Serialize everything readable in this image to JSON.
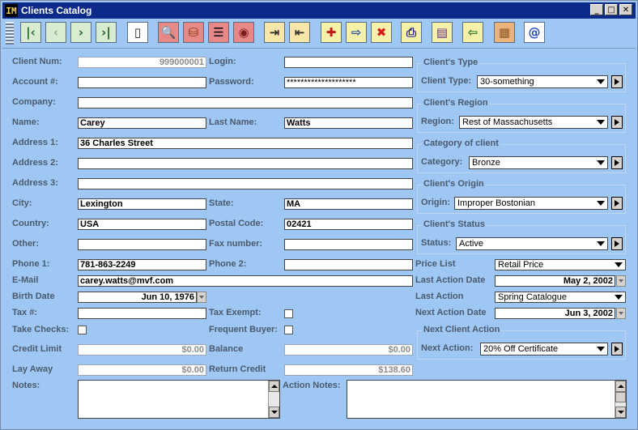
{
  "window": {
    "title": "Clients Catalog",
    "app_icon": "IM",
    "minimize_glyph": "_",
    "maximize_glyph": "□",
    "close_glyph": "✕"
  },
  "toolbar": {
    "buttons": [
      {
        "name": "first-record",
        "icon": "first-record-icon",
        "glyph": "|‹",
        "bg": "#d8ecd2",
        "fg": "#2b6b2b"
      },
      {
        "name": "previous-record",
        "icon": "previous-record-icon",
        "glyph": "‹",
        "bg": "#d8ecd2",
        "fg": "#9aa79a"
      },
      {
        "name": "next-record",
        "icon": "next-record-icon",
        "glyph": "›",
        "bg": "#d8ecd2",
        "fg": "#1f5c1f"
      },
      {
        "name": "last-record",
        "icon": "last-record-icon",
        "glyph": "›|",
        "bg": "#d8ecd2",
        "fg": "#1f5c1f"
      },
      {
        "name": "new-document",
        "icon": "document-icon",
        "glyph": "▯",
        "bg": "#ffffff",
        "fg": "#222222"
      },
      {
        "name": "find",
        "icon": "magnifier-icon",
        "glyph": "🔍",
        "bg": "#e88787",
        "fg": "#222222"
      },
      {
        "name": "database",
        "icon": "database-icon",
        "glyph": "⛁",
        "bg": "#e88787",
        "fg": "#7a3b00"
      },
      {
        "name": "list-view",
        "icon": "list-icon",
        "glyph": "☰",
        "bg": "#e88787",
        "fg": "#000000"
      },
      {
        "name": "view",
        "icon": "eye-icon",
        "glyph": "◉",
        "bg": "#e88787",
        "fg": "#7a1d1d"
      },
      {
        "name": "import",
        "icon": "import-icon",
        "glyph": "⇥",
        "bg": "#f8e6a9",
        "fg": "#2a2a2a"
      },
      {
        "name": "export",
        "icon": "export-icon",
        "glyph": "⇤",
        "bg": "#f8e6a9",
        "fg": "#2a2a2a"
      },
      {
        "name": "add-record",
        "icon": "add-record-icon",
        "glyph": "✚",
        "bg": "#f6f0a8",
        "fg": "#c01818"
      },
      {
        "name": "save-record",
        "icon": "save-record-icon",
        "glyph": "⇨",
        "bg": "#f6f0a8",
        "fg": "#1f4d9c"
      },
      {
        "name": "delete-record",
        "icon": "delete-icon",
        "glyph": "✖",
        "bg": "#f6f0a8",
        "fg": "#d21919"
      },
      {
        "name": "print",
        "icon": "printer-icon",
        "glyph": "⎙",
        "bg": "#f6f0a8",
        "fg": "#1f1f8a"
      },
      {
        "name": "catalog",
        "icon": "catalog-icon",
        "glyph": "▤",
        "bg": "#f6f0a8",
        "fg": "#6b2a8a"
      },
      {
        "name": "exit",
        "icon": "exit-door-icon",
        "glyph": "⇦",
        "bg": "#f6f0a8",
        "fg": "#2a7a2a"
      },
      {
        "name": "grid",
        "icon": "grid-icon",
        "glyph": "▦",
        "bg": "#e9b37a",
        "fg": "#8c5a2a"
      },
      {
        "name": "email",
        "icon": "at-sign-icon",
        "glyph": "@",
        "bg": "#ffffff",
        "fg": "#1f4dbf"
      }
    ]
  },
  "form": {
    "client_num": {
      "label": "Client Num:",
      "value": "999000001"
    },
    "login": {
      "label": "Login:",
      "value": ""
    },
    "account": {
      "label": "Account #:",
      "value": ""
    },
    "password": {
      "label": "Password:",
      "value": "********************"
    },
    "company": {
      "label": "Company:",
      "value": ""
    },
    "name": {
      "label": "Name:",
      "value": "Carey"
    },
    "last_name": {
      "label": "Last Name:",
      "value": "Watts"
    },
    "address1": {
      "label": "Address 1:",
      "value": "36 Charles Street"
    },
    "address2": {
      "label": "Address 2:",
      "value": ""
    },
    "address3": {
      "label": "Address 3:",
      "value": ""
    },
    "city": {
      "label": "City:",
      "value": "Lexington"
    },
    "state": {
      "label": "State:",
      "value": "MA"
    },
    "country": {
      "label": "Country:",
      "value": "USA"
    },
    "postal_code": {
      "label": "Postal Code:",
      "value": "02421"
    },
    "other": {
      "label": "Other:",
      "value": ""
    },
    "fax": {
      "label": "Fax number:",
      "value": ""
    },
    "phone1": {
      "label": "Phone 1:",
      "value": "781-863-2249"
    },
    "phone2": {
      "label": "Phone 2:",
      "value": ""
    },
    "email": {
      "label": "E-Mail",
      "value": "carey.watts@mvf.com"
    },
    "birth_date": {
      "label": "Birth Date",
      "value": "Jun 10, 1976"
    },
    "tax": {
      "label": "Tax #:",
      "value": ""
    },
    "tax_exempt": {
      "label": "Tax Exempt:",
      "checked": false
    },
    "take_checks": {
      "label": "Take Checks:",
      "checked": false
    },
    "frequent_buyer": {
      "label": "Frequent Buyer:",
      "checked": false
    },
    "credit_limit": {
      "label": "Credit Limit",
      "value": "$0.00"
    },
    "balance": {
      "label": "Balance",
      "value": "$0.00"
    },
    "lay_away": {
      "label": "Lay Away",
      "value": "$0.00"
    },
    "return_credit": {
      "label": "Return Credit",
      "value": "$138.60"
    },
    "notes": {
      "label": "Notes:",
      "value": ""
    },
    "action_notes": {
      "label": "Action Notes:",
      "value": ""
    }
  },
  "right": {
    "clients_type": {
      "title": "Client's Type",
      "label": "Client Type:",
      "value": "30-something"
    },
    "clients_region": {
      "title": "Client's Region",
      "label": "Region:",
      "value": "Rest of Massachusetts"
    },
    "category": {
      "title": "Category of client",
      "label": "Category:",
      "value": "Bronze"
    },
    "origin": {
      "title": "Client's Origin",
      "label": "Origin:",
      "value": "Improper Bostonian"
    },
    "status": {
      "title": "Client's Status",
      "label": "Status:",
      "value": "Active"
    },
    "price_list": {
      "label": "Price List",
      "value": "Retail Price"
    },
    "last_action_date": {
      "label": "Last Action Date",
      "value": "May 2, 2002"
    },
    "last_action": {
      "label": "Last Action",
      "value": "Spring Catalogue"
    },
    "next_action_date": {
      "label": "Next Action Date",
      "value": "Jun 3, 2002"
    },
    "next_client_action": {
      "title": "Next Client Action",
      "label": "Next Action:",
      "value": "20% Off Certificate"
    }
  }
}
